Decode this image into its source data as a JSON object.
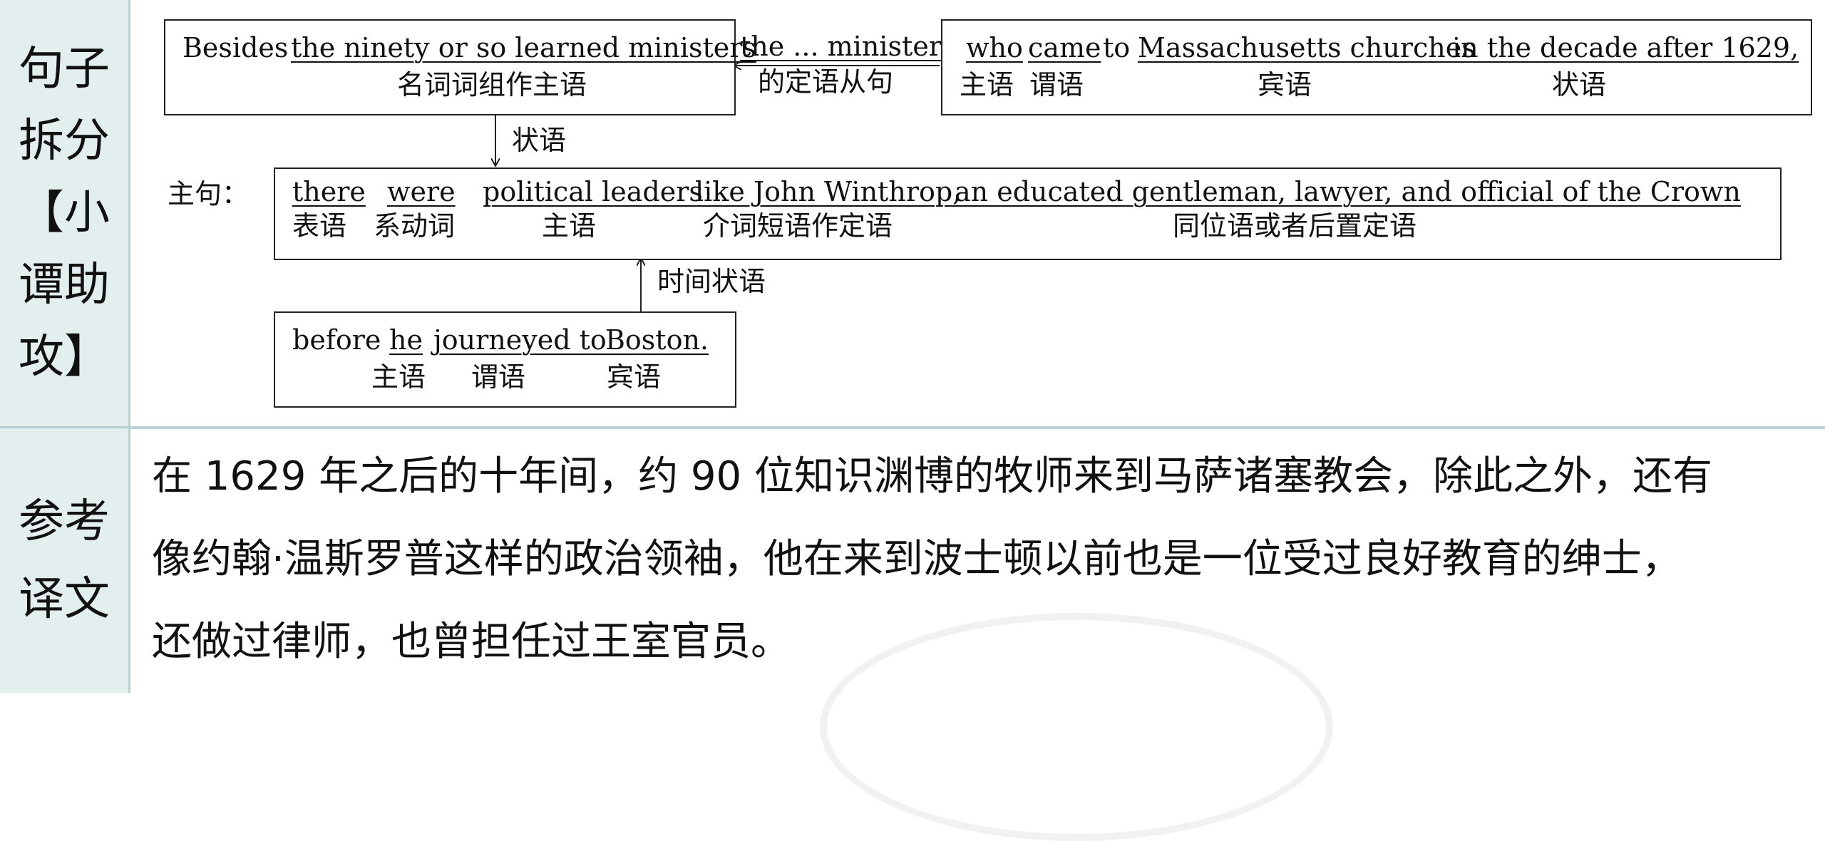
{
  "labels": {
    "analysis": [
      "句子",
      "拆分",
      "【小",
      "谭助",
      "攻】"
    ],
    "translation": [
      "参考",
      "译文"
    ]
  },
  "clause_adverbial": {
    "besides": "Besides",
    "np": "the ninety or so learned ministers",
    "np_role": "名词词组作主语"
  },
  "relative_clause": {
    "ref": "the ... ministers",
    "ref_role": "的定语从句",
    "who": "who",
    "who_role": "主语",
    "came": "came",
    "came_role": "谓语",
    "to": "to",
    "place": "Massachusetts churches",
    "place_role": "宾语",
    "time": "in the decade after 1629,",
    "time_role": "状语"
  },
  "main_clause": {
    "label": "主句：",
    "arrow_label": "状语",
    "there": "there",
    "there_role": "表语",
    "were": "were",
    "were_role": "系动词",
    "subject": "political leaders",
    "subject_role": "主语",
    "like": "like John Winthrop,",
    "like_role": "介词短语作定语",
    "appositive": "an educated gentleman, lawyer, and official of the Crown",
    "appositive_role": "同位语或者后置定语"
  },
  "time_clause": {
    "arrow_label": "时间状语",
    "before": "before",
    "he": "he",
    "he_role": "主语",
    "journeyed": "journeyed to",
    "journeyed_role": "谓语",
    "boston": "Boston.",
    "boston_role": "宾语"
  },
  "translation_lines": [
    "在 1629 年之后的十年间，约 90 位知识渊博的牧师来到马萨诸塞教会，除此之外，还有",
    "像约翰·温斯罗普这样的政治领袖，他在来到波士顿以前也是一位受过良好教育的绅士，",
    "还做过律师，也曾担任过王室官员。"
  ]
}
